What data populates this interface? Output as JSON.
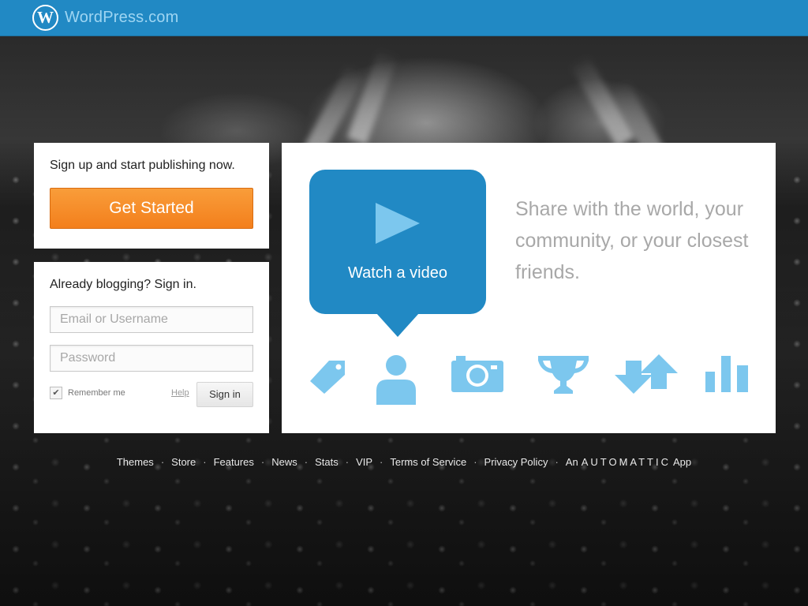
{
  "header": {
    "brand_name": "WordPress.com",
    "logo_letter": "W",
    "bar_color": "#2189c4"
  },
  "signup": {
    "headline": "Sign up and start publishing now.",
    "button_label": "Get Started",
    "button_color": "#f58a24"
  },
  "signin": {
    "headline": "Already blogging? Sign in.",
    "email_placeholder": "Email or Username",
    "email_value": "",
    "password_placeholder": "Password",
    "password_value": "",
    "remember_label": "Remember me",
    "remember_checked": true,
    "checkmark": "✔",
    "help_label": "Help",
    "signin_label": "Sign in"
  },
  "promo": {
    "video_label": "Watch a video",
    "tagline": "Share with the world, your community, or your closest friends.",
    "feature_icons": [
      "tag-icon",
      "user-icon",
      "camera-icon",
      "trophy-icon",
      "reblog-icon",
      "stats-icon"
    ],
    "icon_color": "#7cc7ee"
  },
  "footer": {
    "links": [
      "Themes",
      "Store",
      "Features",
      "News",
      "Stats",
      "VIP",
      "Terms of Service",
      "Privacy Policy"
    ],
    "separator": "·",
    "credit_prefix": "An",
    "credit_brand": "AUTOMATTIC",
    "credit_suffix": "App"
  }
}
